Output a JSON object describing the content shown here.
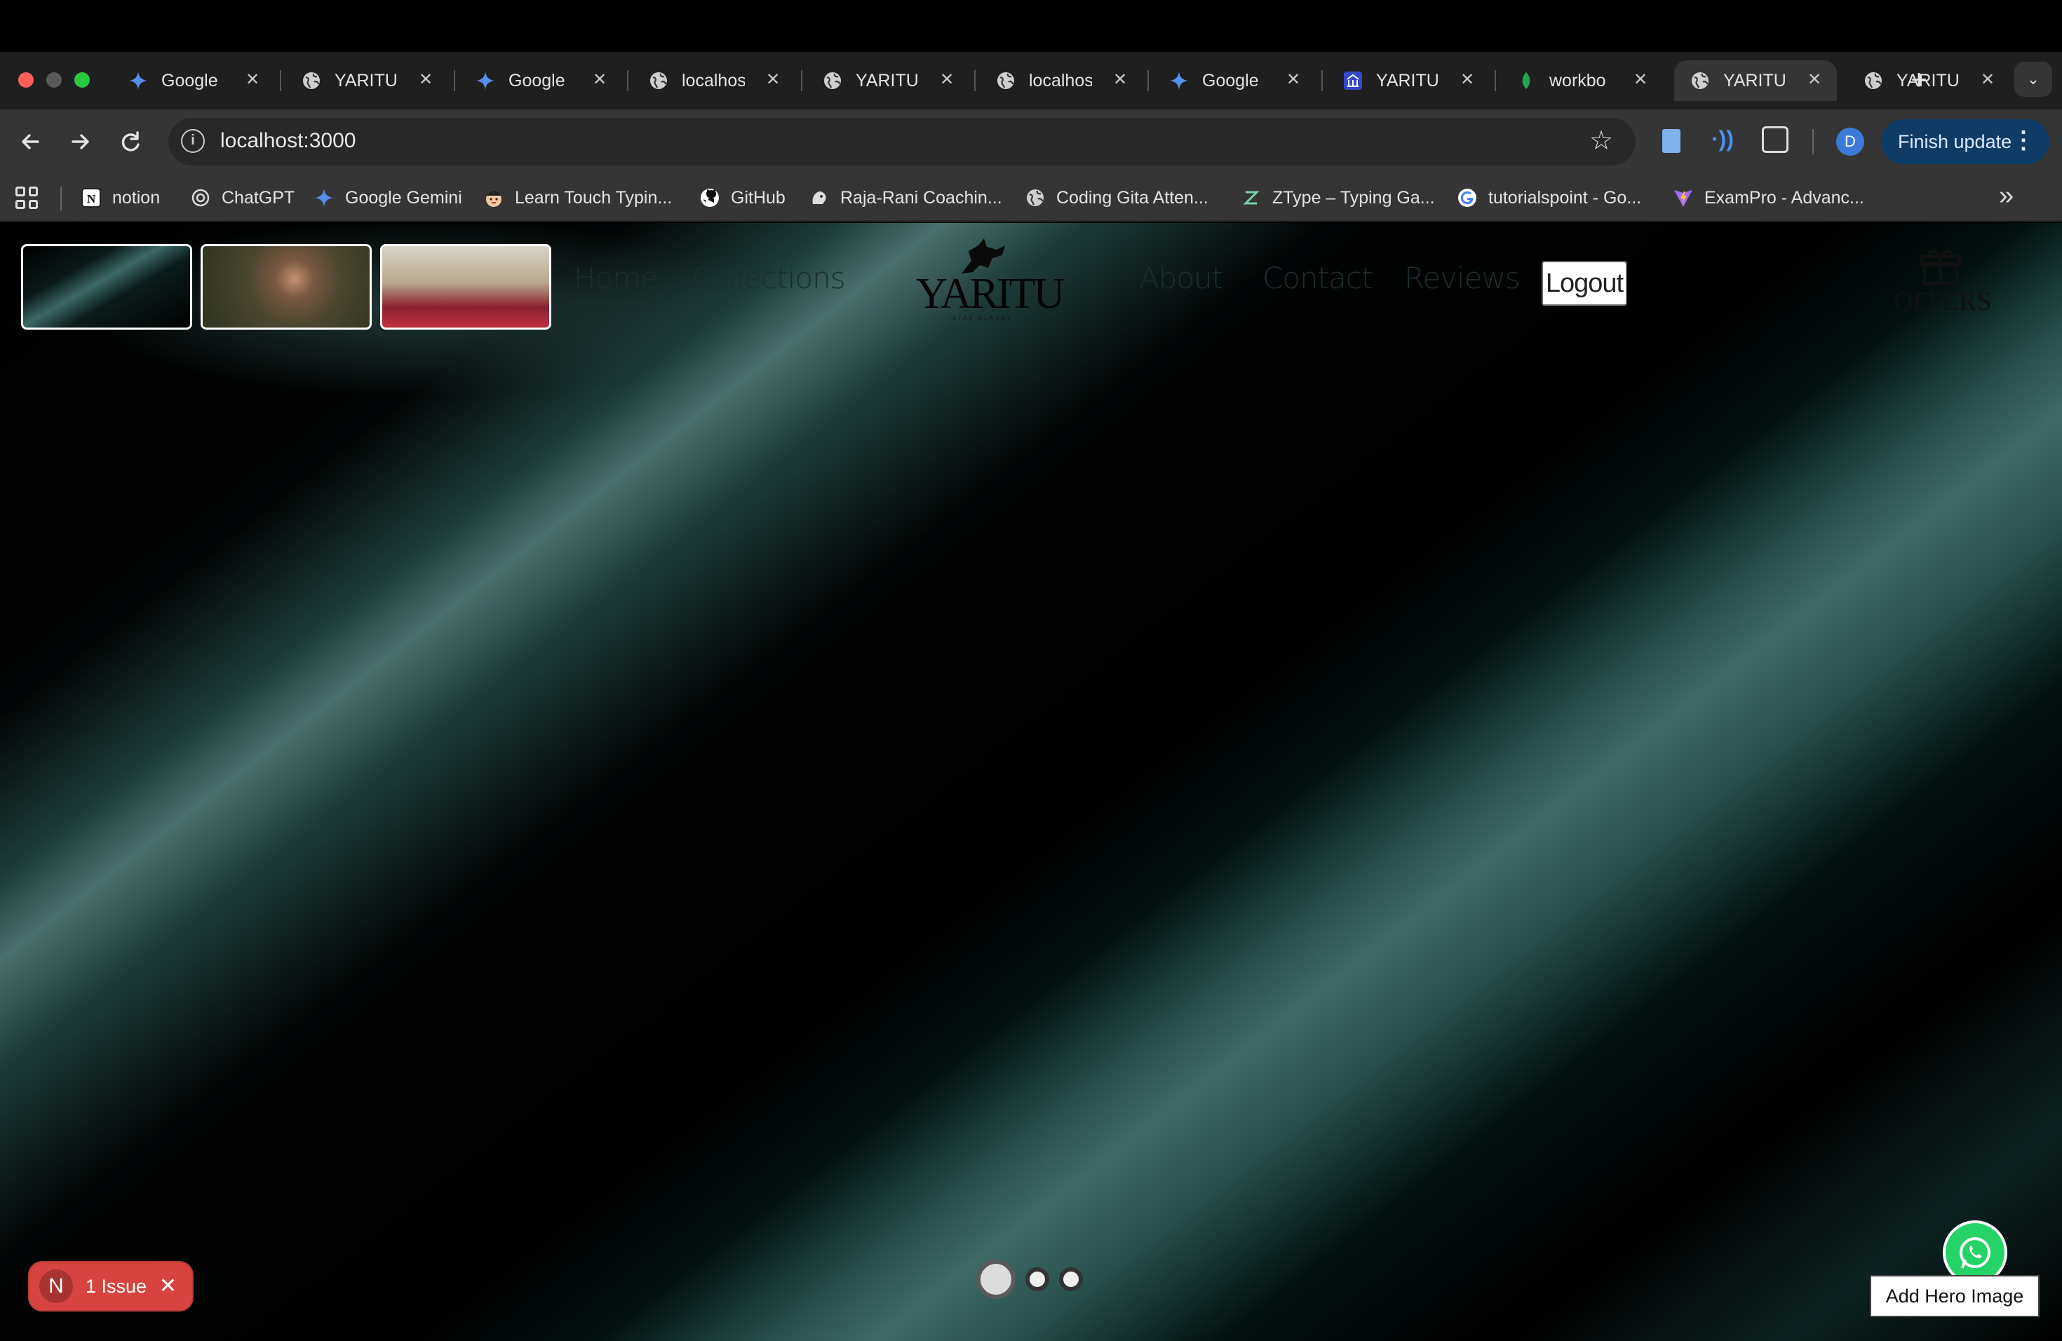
{
  "browser": {
    "tabs": [
      {
        "title": "Google",
        "icon": "gemini-icon",
        "active": false
      },
      {
        "title": "YARITU",
        "icon": "globe-icon",
        "active": false
      },
      {
        "title": "Google",
        "icon": "gemini-icon",
        "active": false
      },
      {
        "title": "localhos",
        "icon": "globe-icon",
        "active": false
      },
      {
        "title": "YARITU",
        "icon": "globe-icon",
        "active": false
      },
      {
        "title": "localhos",
        "icon": "globe-icon",
        "active": false
      },
      {
        "title": "Google",
        "icon": "gemini-icon",
        "active": false
      },
      {
        "title": "YARITU",
        "icon": "bank-icon",
        "active": false
      },
      {
        "title": "workbo",
        "icon": "leaf-icon",
        "active": false
      },
      {
        "title": "YARITU",
        "icon": "globe-icon",
        "active": true
      },
      {
        "title": "YARITU",
        "icon": "globe-icon",
        "active": false
      }
    ],
    "tab_close": "✕",
    "new_tab": "+",
    "url": "localhost:3000",
    "profile_initial": "D",
    "finish_update": "Finish update",
    "bookmarks": [
      {
        "label": "notion",
        "icon": "notion-icon"
      },
      {
        "label": "ChatGPT",
        "icon": "chatgpt-icon"
      },
      {
        "label": "Google Gemini",
        "icon": "gemini-icon"
      },
      {
        "label": "Learn Touch Typin...",
        "icon": "typing-icon"
      },
      {
        "label": "GitHub",
        "icon": "github-icon"
      },
      {
        "label": "Raja-Rani Coachin...",
        "icon": "crown-icon"
      },
      {
        "label": "Coding Gita Atten...",
        "icon": "globe-icon"
      },
      {
        "label": "ZType – Typing Ga...",
        "icon": "ztype-icon"
      },
      {
        "label": "tutorialspoint - Go...",
        "icon": "google-icon"
      },
      {
        "label": "ExamPro - Advanc...",
        "icon": "vite-icon"
      }
    ],
    "bookmarks_more": "»"
  },
  "site": {
    "nav": {
      "home": "Home",
      "collections": "Collections",
      "about": "About",
      "contact": "Contact",
      "reviews": "Reviews",
      "logout": "Logout"
    },
    "logo_text": "YARITU",
    "logo_tagline": "STAY CLASSY",
    "offers": "OFFERS",
    "carousel_dots": 3,
    "carousel_active": 0,
    "add_hero_image": "Add Hero Image",
    "issue_badge": "1 Issue",
    "issue_initial": "N"
  },
  "colors": {
    "chrome_tab_bg": "#1f1f1f",
    "chrome_toolbar_bg": "#353535",
    "finish_update_bg": "#0f3c66",
    "issue_badge_bg": "#d7443f",
    "whatsapp_green": "#25d366"
  }
}
